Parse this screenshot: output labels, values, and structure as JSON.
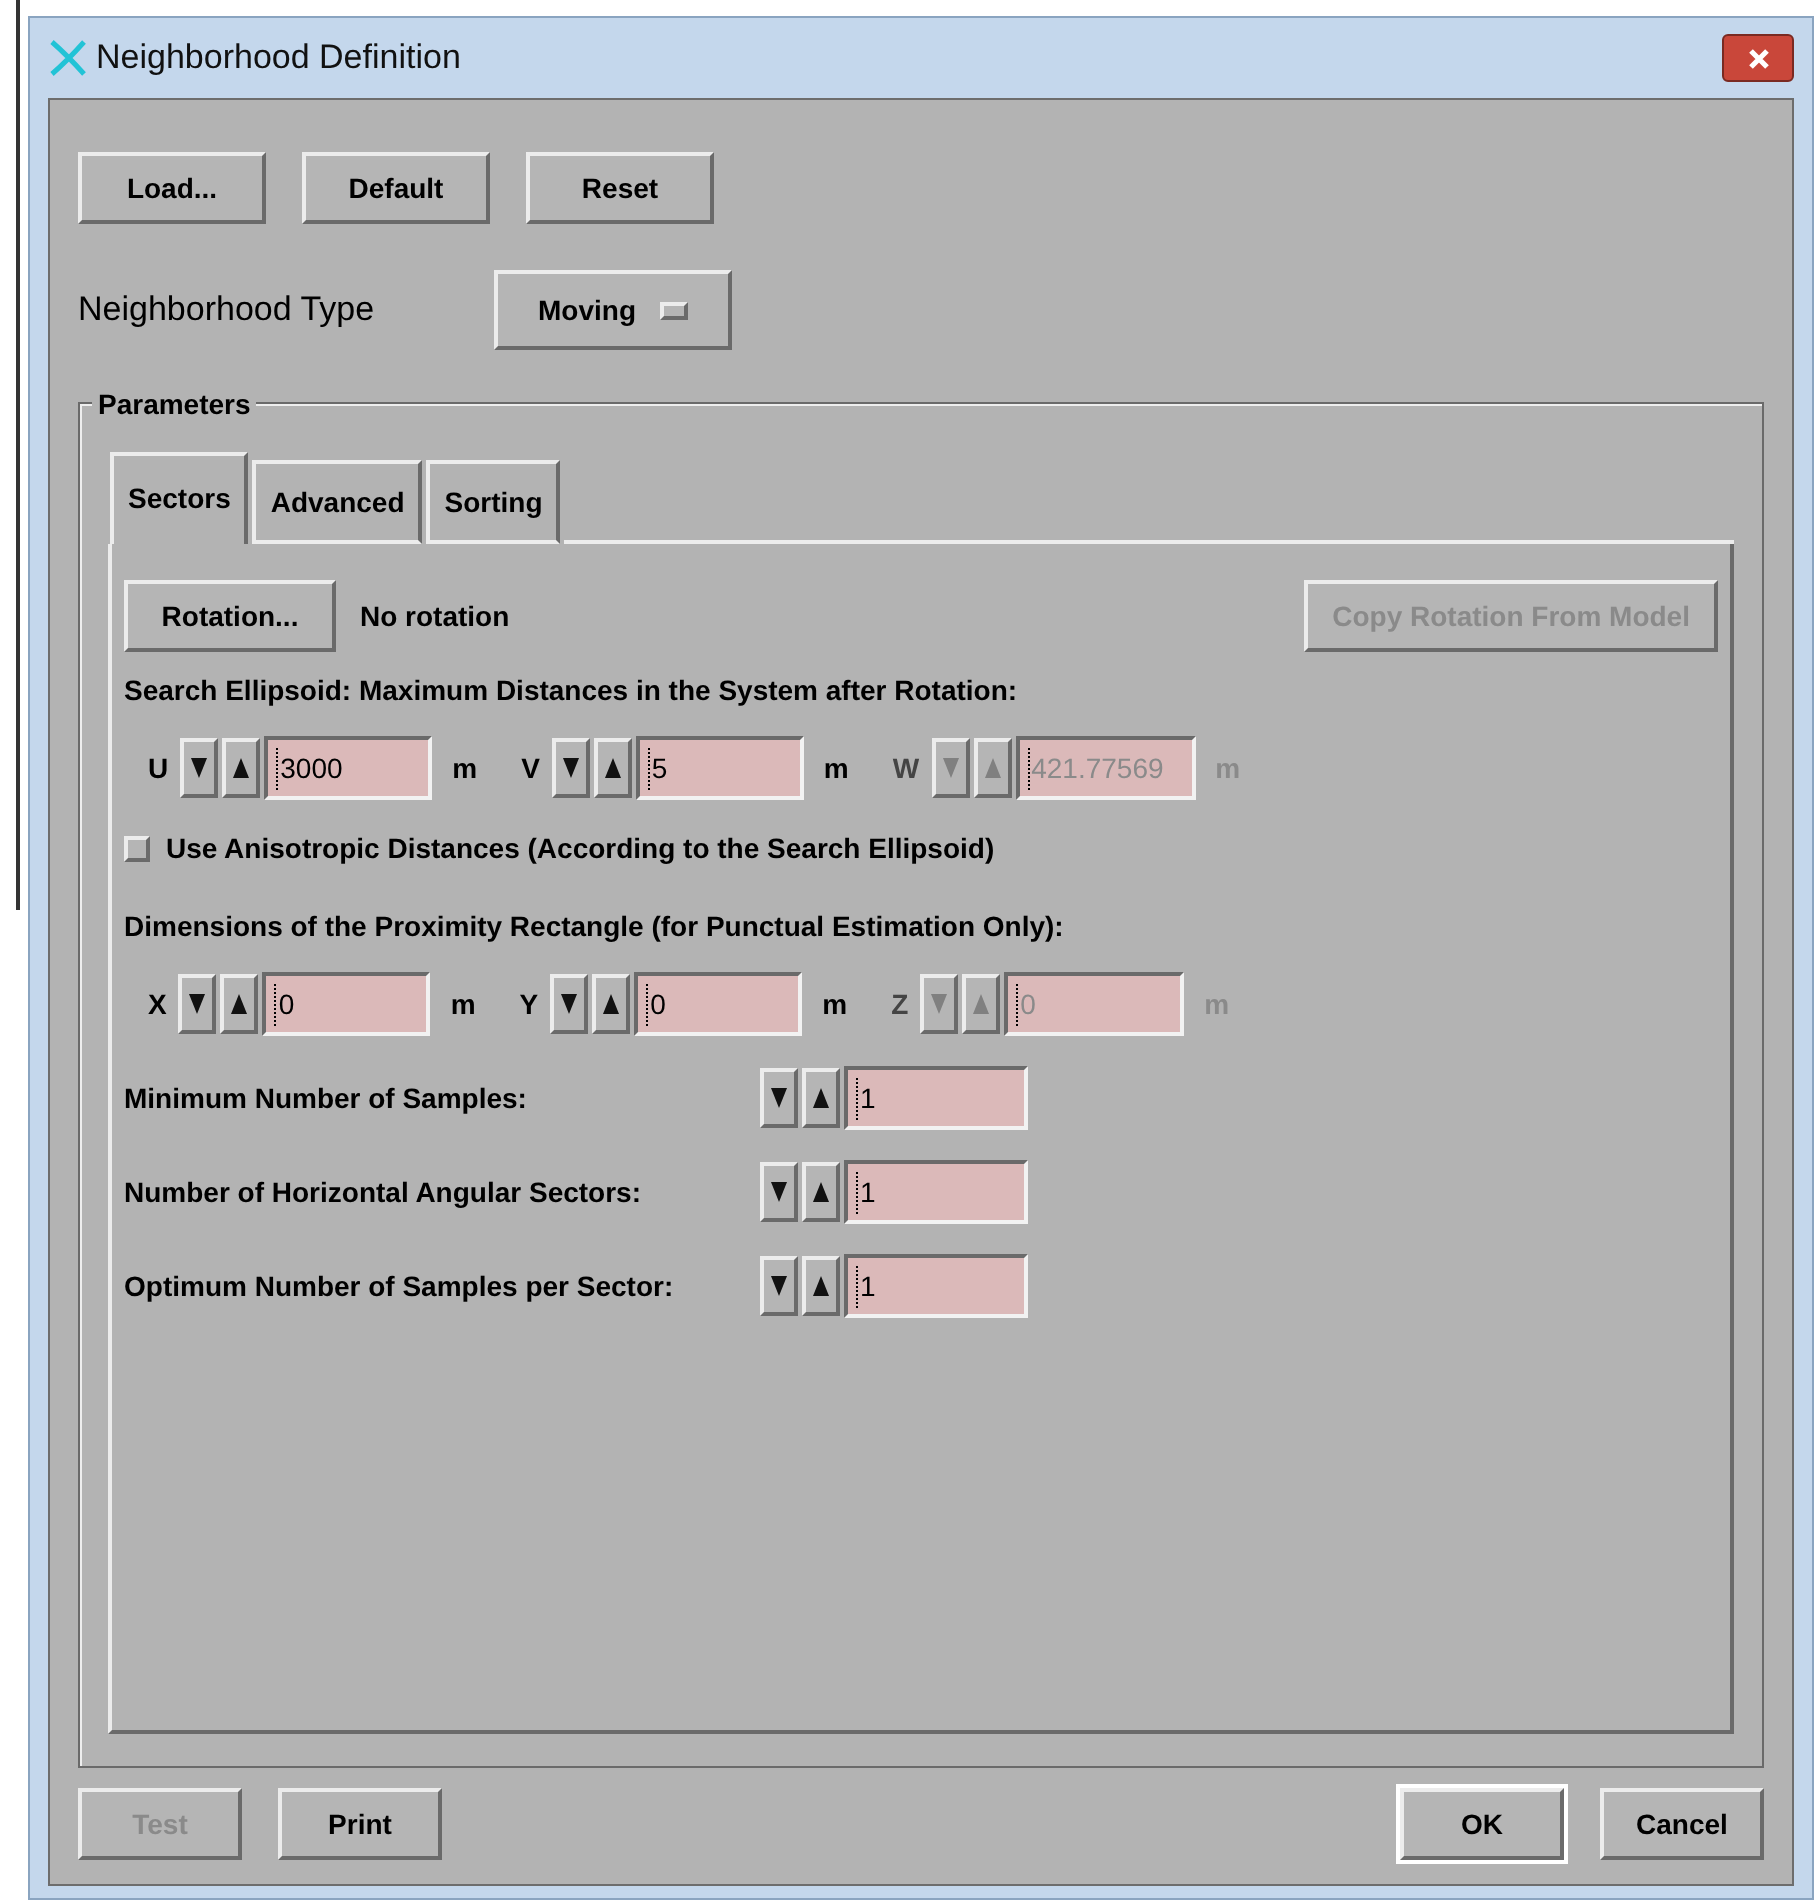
{
  "window": {
    "title": "Neighborhood Definition"
  },
  "top_buttons": [
    {
      "label": "Load..."
    },
    {
      "label": "Default"
    },
    {
      "label": "Reset"
    }
  ],
  "neighborhood_type": {
    "label": "Neighborhood Type",
    "value": "Moving"
  },
  "parameters": {
    "title": "Parameters",
    "tabs": [
      {
        "label": "Sectors",
        "selected": true
      },
      {
        "label": "Advanced",
        "selected": false
      },
      {
        "label": "Sorting",
        "selected": false
      }
    ],
    "rotation": {
      "button": "Rotation...",
      "status": "No rotation",
      "copy_button": {
        "label": "Copy Rotation From Model",
        "disabled": true
      }
    },
    "ellipsoid": {
      "heading": "Search Ellipsoid: Maximum Distances in the System after Rotation:",
      "fields": [
        {
          "axis": "U",
          "value": "3000",
          "unit": "m",
          "disabled": false
        },
        {
          "axis": "V",
          "value": "5",
          "unit": "m",
          "disabled": false
        },
        {
          "axis": "W",
          "value": "421.77569",
          "unit": "m",
          "disabled": true
        }
      ]
    },
    "anisotropic": {
      "label": "Use Anisotropic Distances (According to the Search Ellipsoid)",
      "checked": false
    },
    "proximity": {
      "heading": "Dimensions of the Proximity Rectangle (for Punctual Estimation Only):",
      "fields": [
        {
          "axis": "X",
          "value": "0",
          "unit": "m",
          "disabled": false
        },
        {
          "axis": "Y",
          "value": "0",
          "unit": "m",
          "disabled": false
        },
        {
          "axis": "Z",
          "value": "0",
          "unit": "m",
          "disabled": true
        }
      ]
    },
    "samples": [
      {
        "label": "Minimum Number of Samples:",
        "value": "1"
      },
      {
        "label": "Number of Horizontal Angular Sectors:",
        "value": "1"
      },
      {
        "label": "Optimum Number of Samples per Sector:",
        "value": "1"
      }
    ]
  },
  "footer_buttons": [
    {
      "label": "Test",
      "disabled": true,
      "default": false
    },
    {
      "label": "Print",
      "disabled": false,
      "default": false
    },
    {
      "label": "OK",
      "disabled": false,
      "default": true
    },
    {
      "label": "Cancel",
      "disabled": false,
      "default": false
    }
  ]
}
